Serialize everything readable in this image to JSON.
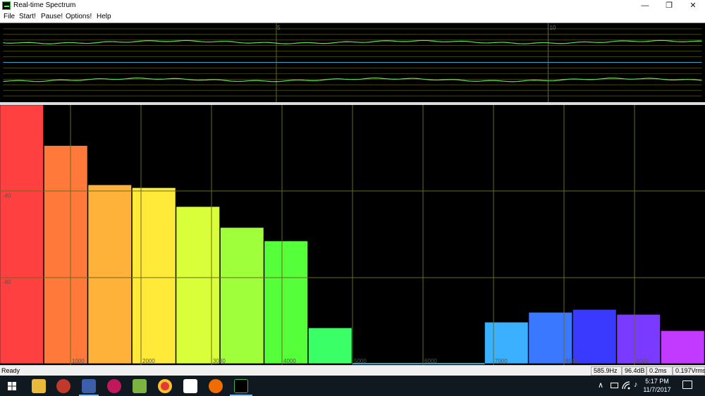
{
  "window": {
    "title": "Real-time Spectrum",
    "minimize": "—",
    "restore": "❐",
    "close": "✕"
  },
  "menu": [
    "File",
    "Start!",
    "Pause!",
    "Options!",
    "Help"
  ],
  "scope": {
    "time_ticks": [
      "5",
      "10"
    ]
  },
  "chart_data": {
    "type": "bar",
    "x_ticks": [
      "1000",
      "2000",
      "3000",
      "4000",
      "5000",
      "6000",
      "7000",
      "8000",
      "9000"
    ],
    "y_ticks": [
      "-40",
      "-80"
    ],
    "bars": [
      {
        "x_start": 0,
        "x_end": 625,
        "level": 1.0,
        "color": "#ff4040"
      },
      {
        "x_start": 625,
        "x_end": 1250,
        "level": 0.843,
        "color": "#ff7a3a"
      },
      {
        "x_start": 1250,
        "x_end": 1875,
        "level": 0.691,
        "color": "#ffb23a"
      },
      {
        "x_start": 1875,
        "x_end": 2500,
        "level": 0.68,
        "color": "#ffea3a"
      },
      {
        "x_start": 2500,
        "x_end": 3125,
        "level": 0.607,
        "color": "#d8ff3a"
      },
      {
        "x_start": 3125,
        "x_end": 3750,
        "level": 0.526,
        "color": "#9eff3a"
      },
      {
        "x_start": 3750,
        "x_end": 4375,
        "level": 0.474,
        "color": "#55ff3a"
      },
      {
        "x_start": 4375,
        "x_end": 5000,
        "level": 0.138,
        "color": "#3aff66"
      },
      {
        "x_start": 6875,
        "x_end": 7500,
        "level": 0.16,
        "color": "#3ab0ff"
      },
      {
        "x_start": 7500,
        "x_end": 8125,
        "level": 0.198,
        "color": "#3a78ff"
      },
      {
        "x_start": 8125,
        "x_end": 8750,
        "level": 0.209,
        "color": "#3a3aff"
      },
      {
        "x_start": 8750,
        "x_end": 9375,
        "level": 0.19,
        "color": "#7a3aff"
      },
      {
        "x_start": 9375,
        "x_end": 10000,
        "level": 0.127,
        "color": "#c23aff"
      }
    ],
    "xlim": [
      0,
      10000
    ],
    "grid": true
  },
  "status": {
    "text": "Ready",
    "frequency": "585.9Hz",
    "level": "96.4dB",
    "latency": "0.2ms",
    "rms": "0.197Vrms"
  },
  "taskbar": {
    "time": "5:17 PM",
    "date": "11/7/2017",
    "tray_chevron": "∧",
    "volume_glyph": "♪"
  },
  "colors": {
    "trace": "#5fe15f",
    "grid": "#6b6b1a"
  }
}
